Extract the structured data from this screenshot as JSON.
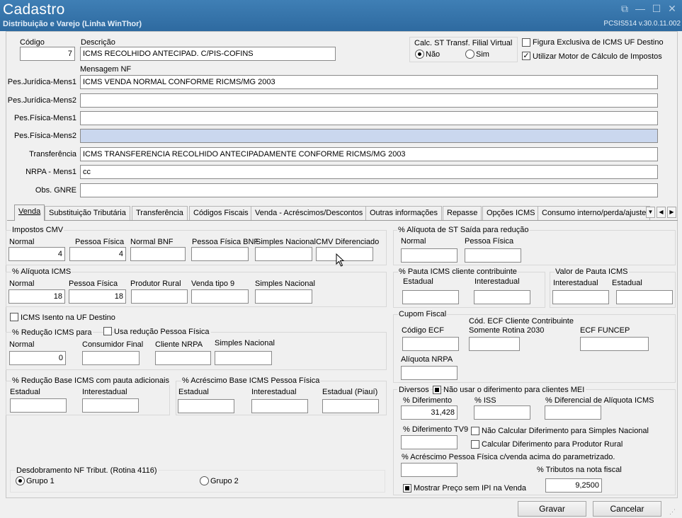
{
  "window": {
    "title": "Cadastro",
    "subtitle": "Distribuição e Varejo (Linha WinThor)",
    "version": "PCSIS514  v.30.0.11.002"
  },
  "header": {
    "codigo_label": "Código",
    "codigo_value": "7",
    "descricao_label": "Descrição",
    "descricao_value": "ICMS RECOLHIDO ANTECIPAD. C/PIS-COFINS",
    "calc_st_label": "Calc. ST Transf. Filial Virtual",
    "calc_st_nao": "Não",
    "calc_st_sim": "Sim",
    "figura_exclusiva": "Figura Exclusiva de ICMS UF Destino",
    "utilizar_motor": "Utilizar Motor de Cálculo de Impostos"
  },
  "mensagens": {
    "title": "Mensagem NF",
    "rows": [
      {
        "label": "Pes.Jurídica-Mens1",
        "value": "ICMS  VENDA NORMAL  CONFORME RICMS/MG 2003"
      },
      {
        "label": "Pes.Jurídica-Mens2",
        "value": ""
      },
      {
        "label": "Pes.Física-Mens1",
        "value": ""
      },
      {
        "label": "Pes.Física-Mens2",
        "value": ""
      },
      {
        "label": "Transferência",
        "value": "ICMS  TRANSFERENCIA  RECOLHIDO ANTECIPADAMENTE CONFORME RICMS/MG 2003"
      },
      {
        "label": "NRPA - Mens1",
        "value": "cc"
      },
      {
        "label": "Obs. GNRE",
        "value": ""
      }
    ]
  },
  "tabs": [
    "Venda",
    "Substituição Tributária",
    "Transferência",
    "Códigos Fiscais",
    "Venda - Acréscimos/Descontos",
    "Outras informações",
    "Repasse",
    "Opções ICMS",
    "Consumo interno/perda/ajuste"
  ],
  "impostos_cmv": {
    "title": "Impostos CMV",
    "cols": [
      {
        "label": "Normal",
        "value": "4"
      },
      {
        "label": "Pessoa Física",
        "value": "4"
      },
      {
        "label": "Normal BNF",
        "value": ""
      },
      {
        "label": "Pessoa Física BNF",
        "value": ""
      },
      {
        "label": "Simples Nacional",
        "value": ""
      },
      {
        "label": "CMV Diferenciado",
        "value": ""
      }
    ]
  },
  "aliquota_icms": {
    "title": "% Alíquota ICMS",
    "cols": [
      {
        "label": "Normal",
        "value": "18"
      },
      {
        "label": "Pessoa Física",
        "value": "18"
      },
      {
        "label": "Produtor Rural",
        "value": ""
      },
      {
        "label": "Venda tipo 9",
        "value": ""
      },
      {
        "label": "Simples Nacional",
        "value": ""
      }
    ]
  },
  "icms_isento": "ICMS Isento na UF Destino",
  "reducao_icms": {
    "title": "% Redução ICMS para",
    "usa_reducao": "Usa redução Pessoa Física",
    "cols": [
      {
        "label": "Normal",
        "value": "0"
      },
      {
        "label": "Consumidor Final",
        "value": ""
      },
      {
        "label": "Cliente NRPA",
        "value": ""
      },
      {
        "label": "Simples Nacional",
        "value": ""
      }
    ]
  },
  "reducao_base": {
    "title": "% Redução Base ICMS com pauta adicionais",
    "cols": [
      {
        "label": "Estadual",
        "value": ""
      },
      {
        "label": "Interestadual",
        "value": ""
      }
    ]
  },
  "acrescimo_base": {
    "title": "% Acréscimo Base ICMS Pessoa Física",
    "cols": [
      {
        "label": "Estadual",
        "value": ""
      },
      {
        "label": "Interestadual",
        "value": ""
      },
      {
        "label": "Estadual (Piauí)",
        "value": ""
      }
    ]
  },
  "desdobramento": {
    "title": "Desdobramento NF Tribut. (Rotina 4116)",
    "grupo1": "Grupo 1",
    "grupo2": "Grupo 2"
  },
  "aliquota_st": {
    "title": "% Alíquota de ST Saída para redução",
    "cols": [
      {
        "label": "Normal",
        "value": ""
      },
      {
        "label": "Pessoa Física",
        "value": ""
      }
    ]
  },
  "pauta_icms": {
    "title": "% Pauta ICMS cliente contribuinte",
    "cols": [
      {
        "label": "Estadual",
        "value": ""
      },
      {
        "label": "Interestadual",
        "value": ""
      }
    ]
  },
  "valor_pauta": {
    "title": "Valor de Pauta ICMS",
    "cols": [
      {
        "label": "Interestadual",
        "value": ""
      },
      {
        "label": "Estadual",
        "value": ""
      }
    ]
  },
  "cupom": {
    "title": "Cupom Fiscal",
    "codigo_ecf": "Código ECF",
    "cod_ecf_cliente": "Cód. ECF Cliente Contribuinte",
    "somente_rotina": "Somente Rotina 2030",
    "ecf_funcep": "ECF FUNCEP",
    "aliquota_nrpa": "Alíquota NRPA"
  },
  "diversos": {
    "title": "Diversos",
    "nao_usar": "Não usar o diferimento para clientes MEI",
    "diferimento_label": "% Diferimento",
    "diferimento_value": "31,428",
    "iss_label": "% ISS",
    "dif_aliquota_label": "% Diferencial de Alíquota ICMS",
    "diferimento_tv9": "% Diferimento TV9",
    "nao_calcular": "Não Calcular Diferimento para Simples Nacional",
    "calcular_produtor": "Calcular Diferimento para Produtor Rural",
    "acrescimo_pf": "% Acréscimo Pessoa Física c/venda acima do parametrizado.",
    "tributos_label": "% Tributos na nota fiscal",
    "tributos_value": "9,2500",
    "mostrar_preco": "Mostrar Preço sem IPI na Venda"
  },
  "buttons": {
    "gravar": "Gravar",
    "cancelar": "Cancelar"
  },
  "colors": {
    "titlebar": "#3a78ad",
    "selected_field": "#cad7ee"
  }
}
